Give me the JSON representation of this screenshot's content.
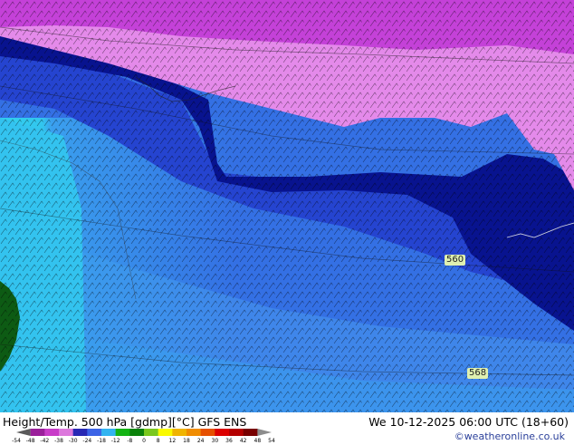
{
  "title": "Height/Temp. 500 hPa [gdmp][°C] GFS ENS",
  "datetime": "We 10-12-2025 06:00 UTC (18+60)",
  "credit": "©weatheronline.co.uk",
  "contour_labels": [
    "560",
    "568"
  ],
  "colorbar": {
    "labels": [
      "-54",
      "-48",
      "-42",
      "-38",
      "-30",
      "-24",
      "-18",
      "-12",
      "-8",
      "0",
      "8",
      "12",
      "18",
      "24",
      "30",
      "36",
      "42",
      "48",
      "54"
    ],
    "colors": [
      "#5a5a5a",
      "#9a1f9a",
      "#c83cc8",
      "#dc78dc",
      "#2828b4",
      "#3c64e6",
      "#32b4f0",
      "#14b414",
      "#0a820a",
      "#7ac81e",
      "#fafa00",
      "#f0b400",
      "#f08c00",
      "#e65000",
      "#dc0000",
      "#b40000",
      "#780000",
      "#8c8c8c"
    ]
  },
  "map_colors": {
    "magenta": "#c23fd6",
    "pink": "#e58aed",
    "navy": "#08108a",
    "blue": "#203ccc",
    "mid_blue": "#3a6fe6",
    "light_blue": "#3a9fee",
    "cyan": "#32d0ee",
    "green": "#0e5a14"
  }
}
